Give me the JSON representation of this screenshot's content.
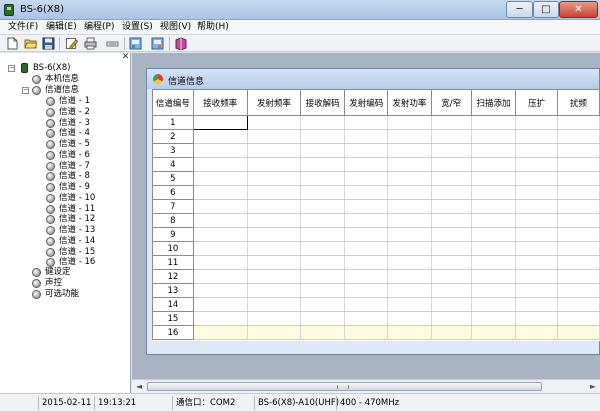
{
  "window": {
    "title": "BS-6(X8)",
    "minimize": "─",
    "maximize": "□",
    "close": "✕"
  },
  "menu": [
    {
      "label": "文件(F)"
    },
    {
      "label": "编辑(E)"
    },
    {
      "label": "编程(P)"
    },
    {
      "label": "设置(S)"
    },
    {
      "label": "视图(V)"
    },
    {
      "label": "帮助(H)"
    }
  ],
  "toolbar": {
    "icons": [
      "new-file-icon",
      "open-folder-icon",
      "save-icon",
      "edit-icon",
      "print-icon",
      "radio-read-icon",
      "write-radio-icon",
      "read-radio-icon",
      "book-icon"
    ]
  },
  "tree": {
    "close_glyph": "✕",
    "root": "BS-6(X8)",
    "items": {
      "machine_info": "本机信息",
      "channel_info": "信道信息",
      "key_setting": "健设定",
      "voice_control": "声控",
      "optional_features": "可选功能"
    },
    "channels": [
      "信道 - 1",
      "信道 - 2",
      "信道 - 3",
      "信道 - 4",
      "信道 - 5",
      "信道 - 6",
      "信道 - 7",
      "信道 - 8",
      "信道 - 9",
      "信道 - 10",
      "信道 - 11",
      "信道 - 12",
      "信道 - 13",
      "信道 - 14",
      "信道 - 15",
      "信道 - 16"
    ]
  },
  "child_window": {
    "title": "信道信息"
  },
  "grid": {
    "headers": [
      "信道编号",
      "接收频率",
      "发射频率",
      "接收解码",
      "发射编码",
      "发射功率",
      "宽/窄",
      "扫描添加",
      "压扩",
      "扰频"
    ],
    "rows": [
      "1",
      "2",
      "3",
      "4",
      "5",
      "6",
      "7",
      "8",
      "9",
      "10",
      "11",
      "12",
      "13",
      "14",
      "15",
      "16"
    ]
  },
  "scrollbar": {
    "left": "◄",
    "right": "►"
  },
  "status": {
    "date": "2015-02-11",
    "time": "19:13:21",
    "port": "通信口：COM2",
    "model": "BS-6(X8)-A10(UHF)",
    "band": "400 - 470MHz"
  },
  "colors": {
    "last_row_fill": "#fffbe0",
    "titlebar": "#a9c4e6",
    "close_button": "#c84530"
  }
}
